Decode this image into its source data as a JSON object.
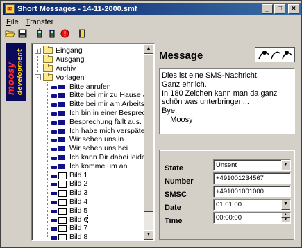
{
  "window": {
    "title": "Short Messages - 14-11-2000.smf",
    "minimize": "_",
    "maximize": "□",
    "close": "×"
  },
  "menu": {
    "file": "File",
    "transfer": "Transfer"
  },
  "logo": {
    "text": "moosy",
    "subtext": "development"
  },
  "tree": {
    "folders": [
      {
        "label": "Eingang",
        "expander": "+"
      },
      {
        "label": "Ausgang",
        "expander": ""
      },
      {
        "label": "Archiv",
        "expander": ""
      },
      {
        "label": "Vorlagen",
        "expander": "-"
      }
    ],
    "messages": [
      "Bitte anrufen",
      "Bitte bei mir zu Hause an",
      "Bitte bei mir am Arbeitsp",
      "Ich bin in einer Besprech",
      "Besprechung fällt aus.",
      "Ich habe mich verspätet u",
      "Wir sehen uns in",
      "Wir sehen uns bei",
      "Ich kann Dir dabei leider",
      "Ich komme um  an."
    ],
    "pictures": [
      "Bild 1",
      "Bild 2",
      "Bild 3",
      "Bild 4",
      "Bild 5",
      "Bild 6",
      "Bild 7",
      "Bild 8"
    ],
    "selected": "Bild 6",
    "scroll_up": "▲",
    "scroll_down": "▼"
  },
  "message": {
    "header": "Message",
    "body": "Dies ist eine SMS-Nachricht.\nGanz ehrlich.\nIn 180 Zeichen kann man da ganz\nschön was unterbringen...\nBye,\n    Moosy"
  },
  "details": {
    "state_label": "State",
    "state_value": "Unsent",
    "number_label": "Number",
    "number_value": "+491001234567",
    "smsc_label": "SMSC",
    "smsc_value": "+491001001000",
    "date_label": "Date",
    "date_value": "01.01.00",
    "time_label": "Time",
    "time_value": "00:00:00",
    "dropdown_arrow": "▼",
    "spin_up": "▲",
    "spin_down": "▼"
  }
}
